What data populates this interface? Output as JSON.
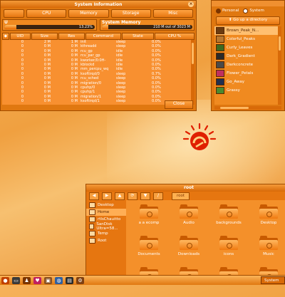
{
  "sysinfo": {
    "title": "System Information",
    "tabs": [
      "CPU",
      "Memory",
      "Storage",
      "Misc"
    ],
    "cpu": {
      "label": "U",
      "percent_text": "13.23%",
      "percent": 13.23
    },
    "memory": {
      "label": "System Memory",
      "usage_text": "210 M out of 3023 M",
      "fraction": 0.07
    },
    "columns": [
      "UID",
      "Size",
      "Res",
      "Command",
      "State",
      "CPU %"
    ],
    "processes": [
      [
        "0",
        "2 M",
        "1 M",
        "init",
        "sleep",
        "0.0%"
      ],
      [
        "0",
        "0 M",
        "0 M",
        "kthreadd",
        "sleep",
        "0.0%"
      ],
      [
        "0",
        "0 M",
        "0 M",
        "rcu_gp",
        "idle",
        "0.0%"
      ],
      [
        "0",
        "0 M",
        "0 M",
        "rcu_par_gp",
        "idle",
        "0.0%"
      ],
      [
        "0",
        "0 M",
        "0 M",
        "kworker/0:0H-",
        "idle",
        "0.0%"
      ],
      [
        "0",
        "0 M",
        "0 M",
        "kblockd",
        "idle",
        "0.0%"
      ],
      [
        "0",
        "0 M",
        "0 M",
        "mm_percpu_wq",
        "idle",
        "0.0%"
      ],
      [
        "0",
        "0 M",
        "0 M",
        "ksoftirqd/0",
        "sleep",
        "0.7%"
      ],
      [
        "0",
        "0 M",
        "0 M",
        "rcu_sched",
        "sleep",
        "0.0%"
      ],
      [
        "0",
        "0 M",
        "0 M",
        "migration/0",
        "sleep",
        "0.0%"
      ],
      [
        "0",
        "0 M",
        "0 M",
        "cpuhp/0",
        "sleep",
        "0.0%"
      ],
      [
        "0",
        "0 M",
        "0 M",
        "cpuhp/1",
        "sleep",
        "0.0%"
      ],
      [
        "0",
        "0 M",
        "0 M",
        "migration/1",
        "sleep",
        "0.0%"
      ],
      [
        "0",
        "0 M",
        "0 M",
        "ksoftirqd/1",
        "sleep",
        "0.0%"
      ]
    ],
    "close_label": "Close"
  },
  "themes": {
    "radio_personal": "Personal",
    "radio_system": "System",
    "go_up_label": "Go up a directory",
    "items": [
      {
        "name": "Brown_Peak_N...",
        "color": "#6a3a10"
      },
      {
        "name": "Colorful_Peaks",
        "color": "#b87830"
      },
      {
        "name": "Curly_Leaves",
        "color": "#3e6a20"
      },
      {
        "name": "Dark_Gradient",
        "color": "#2a2a2a"
      },
      {
        "name": "Darkconcrete",
        "color": "#4a4a4a"
      },
      {
        "name": "Flower_Petals",
        "color": "#c03060"
      },
      {
        "name": "Go_Away",
        "color": "#203050"
      },
      {
        "name": "Grassy",
        "color": "#4a8a30"
      }
    ],
    "selected_index": 0
  },
  "files": {
    "title": "root",
    "breadcrumb": "root",
    "places": [
      "Desktop",
      "Home",
      "rtlsChauitto",
      "SanDisk Ultra=58...",
      "Temp",
      "Root"
    ],
    "selected_place_index": 1,
    "folders": [
      "a a ecomp",
      "Audio",
      "backgrounds",
      "Desktop",
      "Documents",
      "Downloads",
      "icons",
      "Music",
      "",
      "",
      "",
      ""
    ]
  },
  "taskbar": {
    "system_label": "System"
  },
  "colors": {
    "accent": "#e07810",
    "accent_dark": "#a04c00",
    "logo_red": "#e02000"
  }
}
